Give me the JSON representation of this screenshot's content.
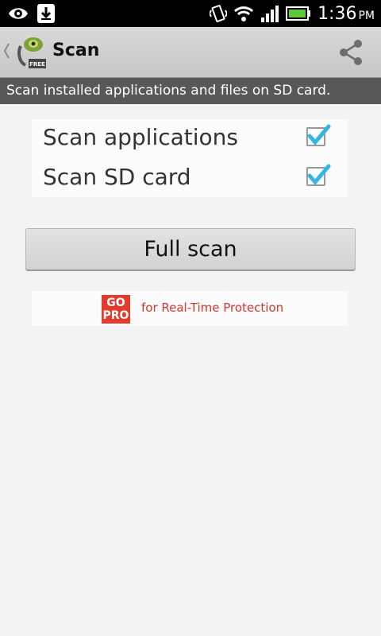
{
  "status_bar": {
    "time": "1:36",
    "ampm": "PM"
  },
  "action_bar": {
    "title": "Scan",
    "icon_badge": "FREE"
  },
  "description": "Scan installed applications and files on SD card.",
  "options": [
    {
      "label": "Scan applications",
      "checked": true
    },
    {
      "label": "Scan SD card",
      "checked": true
    }
  ],
  "full_scan_label": "Full scan",
  "gopro": {
    "logo_top": "GO",
    "logo_bottom": "PRO",
    "text": "for Real-Time Protection"
  },
  "colors": {
    "accent_check": "#33b5e5",
    "promo_red": "#e43b2f"
  }
}
